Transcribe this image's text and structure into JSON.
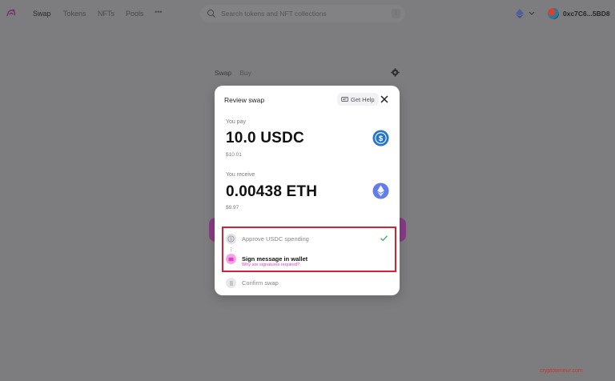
{
  "nav": {
    "items": [
      {
        "label": "Swap"
      },
      {
        "label": "Tokens"
      },
      {
        "label": "NFTs"
      },
      {
        "label": "Pools"
      }
    ],
    "more": "•••",
    "search_placeholder": "Search tokens and NFT collections",
    "search_shortcut": "/",
    "wallet_address": "0xc7C6...5BD8"
  },
  "swap_tabs": [
    "Swap",
    "Buy"
  ],
  "modal": {
    "title": "Review swap",
    "help_label": "Get Help",
    "pay": {
      "label": "You pay",
      "amount": "10.0 USDC",
      "usd": "$10.01"
    },
    "receive": {
      "label": "You receive",
      "amount": "0.00438 ETH",
      "usd": "$9.97"
    },
    "steps": [
      {
        "label": "Approve USDC spending",
        "status": "complete"
      },
      {
        "label": "Sign message in wallet",
        "status": "active",
        "help_link": "Why are signatures required?"
      },
      {
        "label": "Confirm swap",
        "status": "pending"
      }
    ]
  },
  "colors": {
    "accent_pink": "#e040c8",
    "usdc_blue": "#2775ca",
    "eth_purple": "#627eea",
    "highlight_red": "#d12335"
  },
  "watermark": "cryptoteneur.com"
}
